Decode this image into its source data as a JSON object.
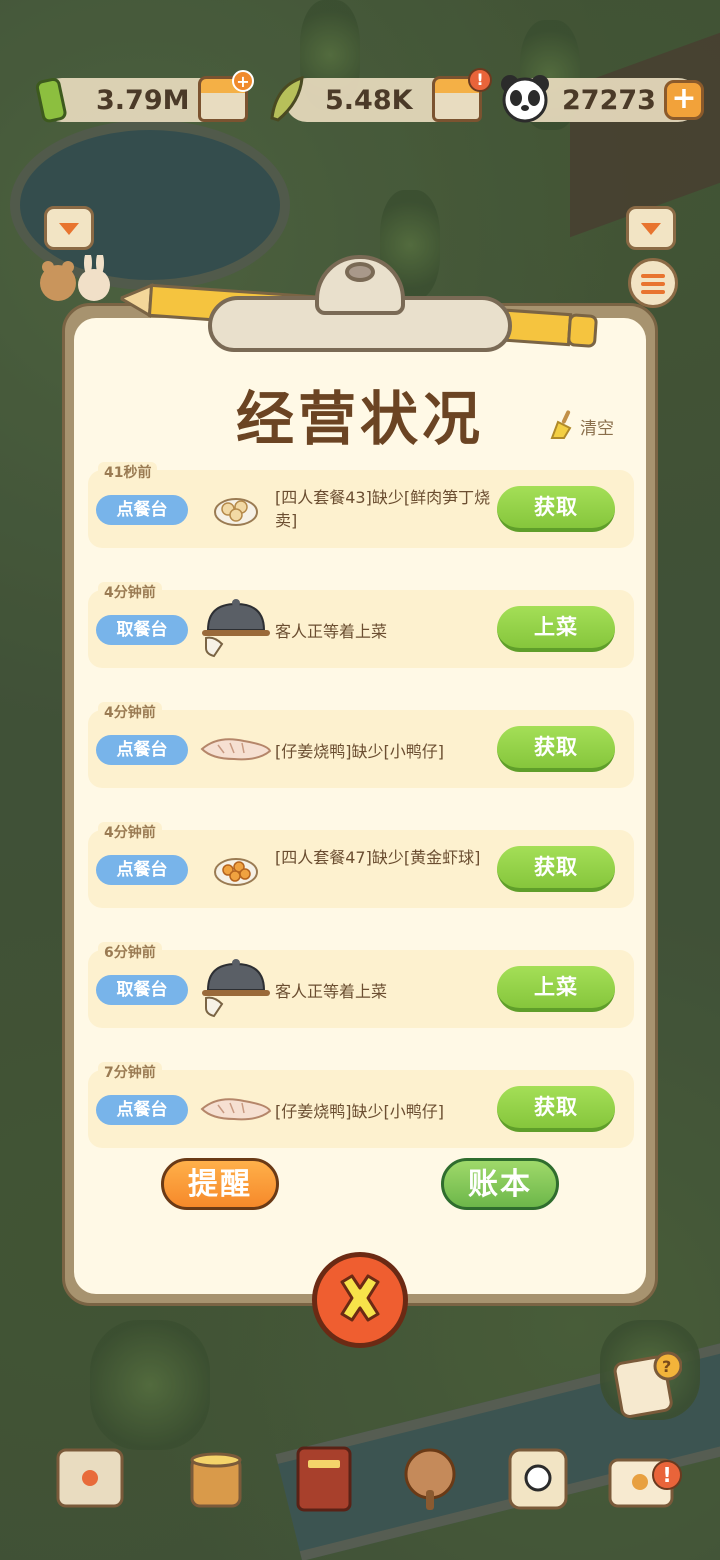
{
  "resources": {
    "bamboo_shoots": "3.79M",
    "bamboo": "5.48K",
    "pandas": "27273"
  },
  "panel": {
    "title": "经营状况",
    "clear_label": "清空"
  },
  "entries": [
    {
      "time": "41秒前",
      "tag": "点餐台",
      "icon": "dumpling-dish-icon",
      "text": "[四人套餐43]缺少[鲜肉笋丁烧卖]",
      "action": "获取"
    },
    {
      "time": "4分钟前",
      "tag": "取餐台",
      "icon": "serving-cloche-icon",
      "text": "客人正等着上菜",
      "action": "上菜"
    },
    {
      "time": "4分钟前",
      "tag": "点餐台",
      "icon": "raw-duck-icon",
      "text": "[仔姜烧鸭]缺少[小鸭仔]",
      "action": "获取"
    },
    {
      "time": "4分钟前",
      "tag": "点餐台",
      "icon": "shrimp-balls-dish-icon",
      "text": "[四人套餐47]缺少[黄金虾球]",
      "action": "获取"
    },
    {
      "time": "6分钟前",
      "tag": "取餐台",
      "icon": "serving-cloche-icon",
      "text": "客人正等着上菜",
      "action": "上菜"
    },
    {
      "time": "7分钟前",
      "tag": "点餐台",
      "icon": "raw-duck-icon",
      "text": "[仔姜烧鸭]缺少[小鸭仔]",
      "action": "获取"
    }
  ],
  "buttons": {
    "remind": "提醒",
    "ledger": "账本"
  },
  "colors": {
    "title": "#6b4423",
    "tag_blue": "#78b4ea",
    "action_green": "#86c63c",
    "remind_orange": "#f6892a",
    "ledger_green": "#6db74a",
    "close_red": "#ef5e30"
  }
}
